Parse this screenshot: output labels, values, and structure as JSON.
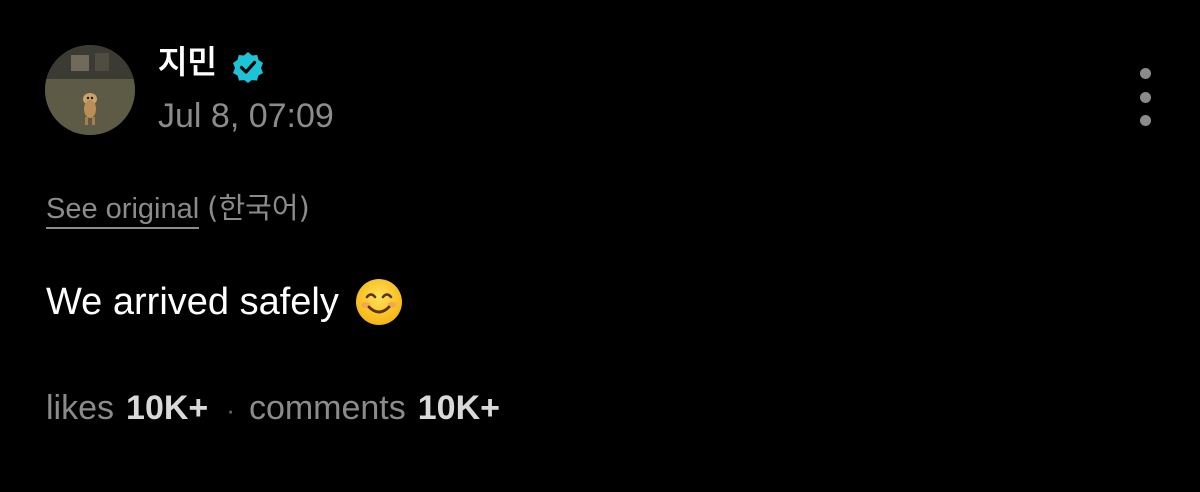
{
  "post": {
    "author": {
      "name": "지민",
      "verified": true,
      "avatar_icon": "avatar-dog-photo"
    },
    "timestamp": "Jul 8, 07:09",
    "translation": {
      "link_label": "See original",
      "language": "(한국어)"
    },
    "text": "We arrived safely",
    "emoji_icon": "smiling-face-icon",
    "stats": {
      "likes_label": "likes",
      "likes_count": "10K+",
      "separator": "·",
      "comments_label": "comments",
      "comments_count": "10K+"
    }
  },
  "colors": {
    "background": "#000000",
    "primary_text": "#ffffff",
    "secondary_text": "#8b8b8b",
    "verified_badge": "#1dc3d6"
  }
}
